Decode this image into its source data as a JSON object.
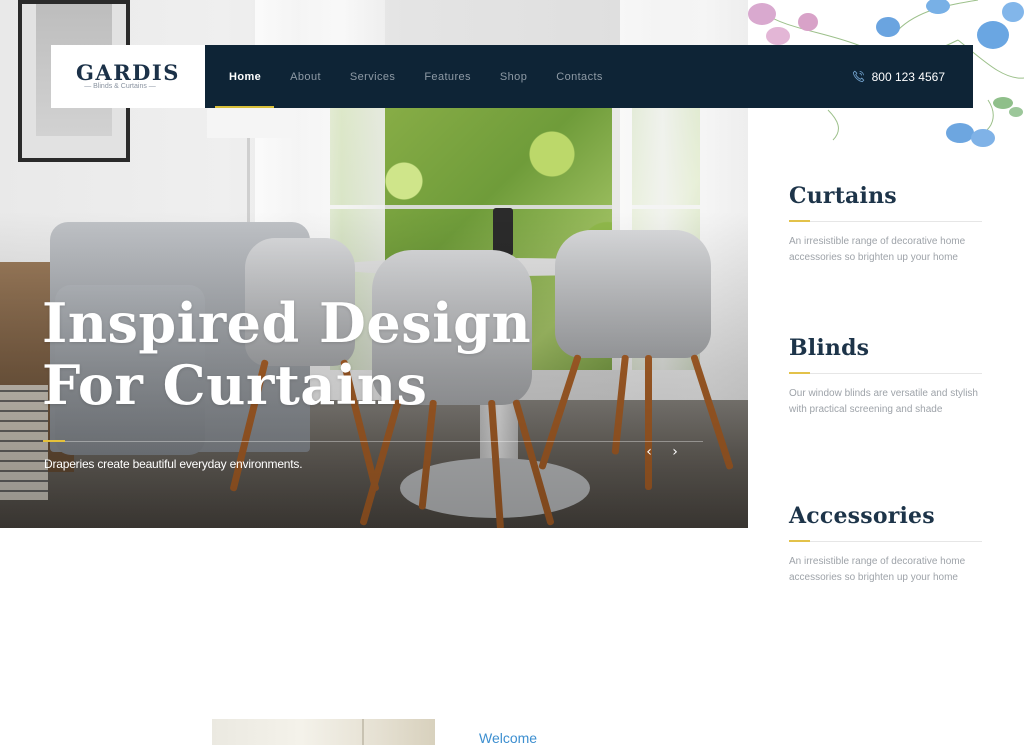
{
  "brand": {
    "name": "GARDIS",
    "tagline": "— Blinds & Curtains —"
  },
  "nav": {
    "items": [
      {
        "label": "Home",
        "active": true
      },
      {
        "label": "About",
        "active": false
      },
      {
        "label": "Services",
        "active": false
      },
      {
        "label": "Features",
        "active": false
      },
      {
        "label": "Shop",
        "active": false
      },
      {
        "label": "Contacts",
        "active": false
      }
    ],
    "phone": "800 123 4567",
    "phone_icon": "phone-icon"
  },
  "hero": {
    "title_line1": "Inspired Design",
    "title_line2": "For Curtains",
    "subtitle": "Draperies create beautiful everyday environments.",
    "prev_label": "‹",
    "next_label": "›"
  },
  "categories": [
    {
      "title": "Curtains",
      "description": "An irresistible range of decorative home accessories so brighten up your home"
    },
    {
      "title": "Blinds",
      "description": "Our window blinds are versatile and stylish with practical screening and shade"
    },
    {
      "title": "Accessories",
      "description": "An irresistible range of decorative home accessories so brighten up your home"
    }
  ],
  "welcome": {
    "label": "Welcome"
  },
  "colors": {
    "nav_bg": "#0e2436",
    "accent": "#e3c24a",
    "heading": "#1d3449",
    "body_text": "#9ea3a9",
    "link_blue": "#3d8fd0"
  }
}
